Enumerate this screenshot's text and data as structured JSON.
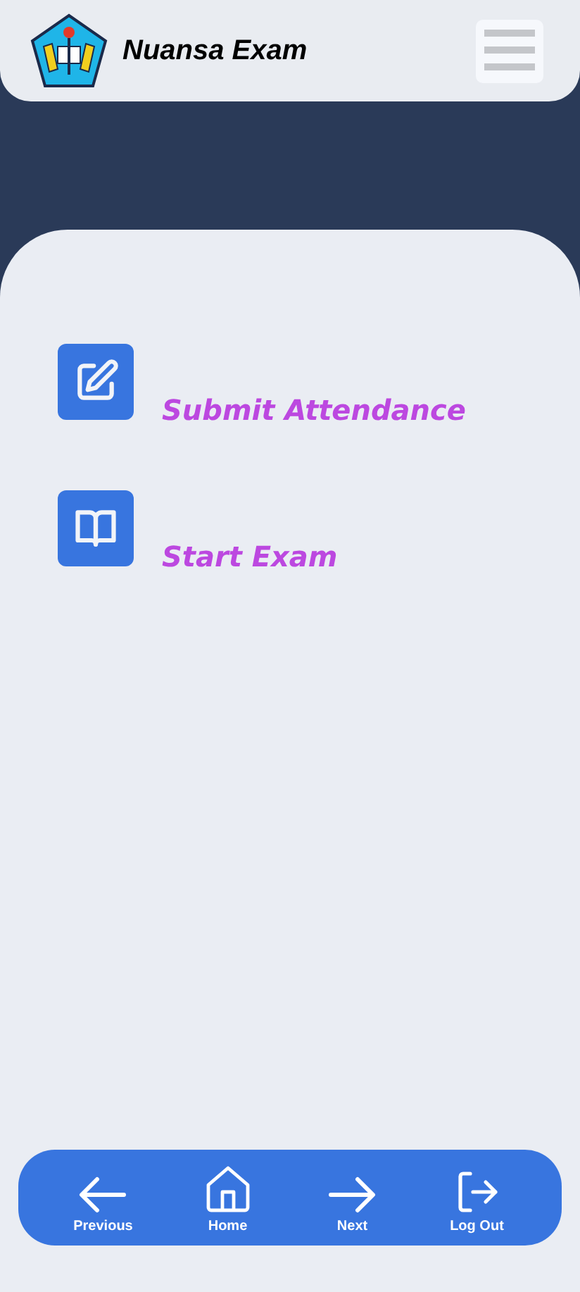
{
  "header": {
    "title": "Nuansa Exam"
  },
  "menu": [
    {
      "kind": "attendance",
      "label": "Submit Attendance"
    },
    {
      "kind": "exam",
      "label": "Start Exam"
    }
  ],
  "bottom_nav": [
    {
      "kind": "previous",
      "label": "Previous"
    },
    {
      "kind": "home",
      "label": "Home"
    },
    {
      "kind": "next",
      "label": "Next"
    },
    {
      "kind": "logout",
      "label": "Log Out"
    }
  ]
}
